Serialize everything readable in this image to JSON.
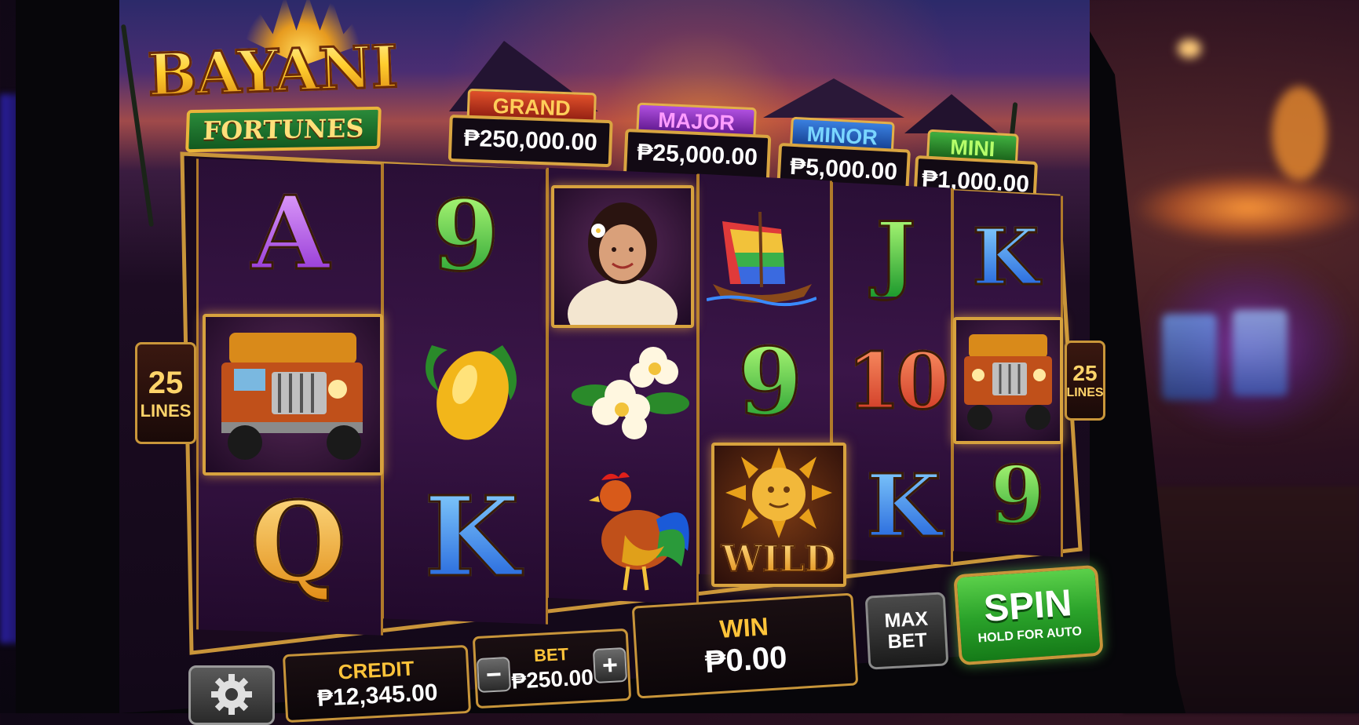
{
  "game": {
    "title": "BAYANI",
    "subtitle": "FORTUNES"
  },
  "jackpots": {
    "grand": {
      "label": "GRAND",
      "value": "₱250,000.00",
      "color": "#c0301c"
    },
    "major": {
      "label": "MAJOR",
      "value": "₱25,000.00",
      "color": "#8a2ab8"
    },
    "minor": {
      "label": "MINOR",
      "value": "₱5,000.00",
      "color": "#1a58b8"
    },
    "mini": {
      "label": "MINI",
      "value": "₱1,000.00",
      "color": "#2a8a2a"
    }
  },
  "lines": {
    "left": {
      "count": "25",
      "label": "LINES"
    },
    "right": {
      "count": "25",
      "label": "LINES"
    }
  },
  "reels": [
    [
      "A",
      "jeepney-icon",
      "Q"
    ],
    [
      "9",
      "mango-icon",
      "K"
    ],
    [
      "maria-clara-icon",
      "sampaguita-flower-icon",
      "rooster-icon"
    ],
    [
      "vinta-boat-icon",
      "9",
      "sun-wild-icon"
    ],
    [
      "J",
      "10",
      "K"
    ],
    [
      "K",
      "jeepney-icon",
      "9"
    ]
  ],
  "symbols": {
    "wild_label": "WILD"
  },
  "controls": {
    "credit_label": "CREDIT",
    "credit_value": "₱12,345.00",
    "bet_label": "BET",
    "bet_value": "₱250.00",
    "bet_minus": "−",
    "bet_plus": "+",
    "win_label": "WIN",
    "win_value": "₱0.00",
    "max_bet_line1": "MAX",
    "max_bet_line2": "BET",
    "spin_label": "SPIN",
    "spin_sub": "HOLD FOR AUTO"
  },
  "colors": {
    "gold": "#e2b04a",
    "reel_bg": "#2a0f36",
    "spin_green": "#2aa22a"
  }
}
